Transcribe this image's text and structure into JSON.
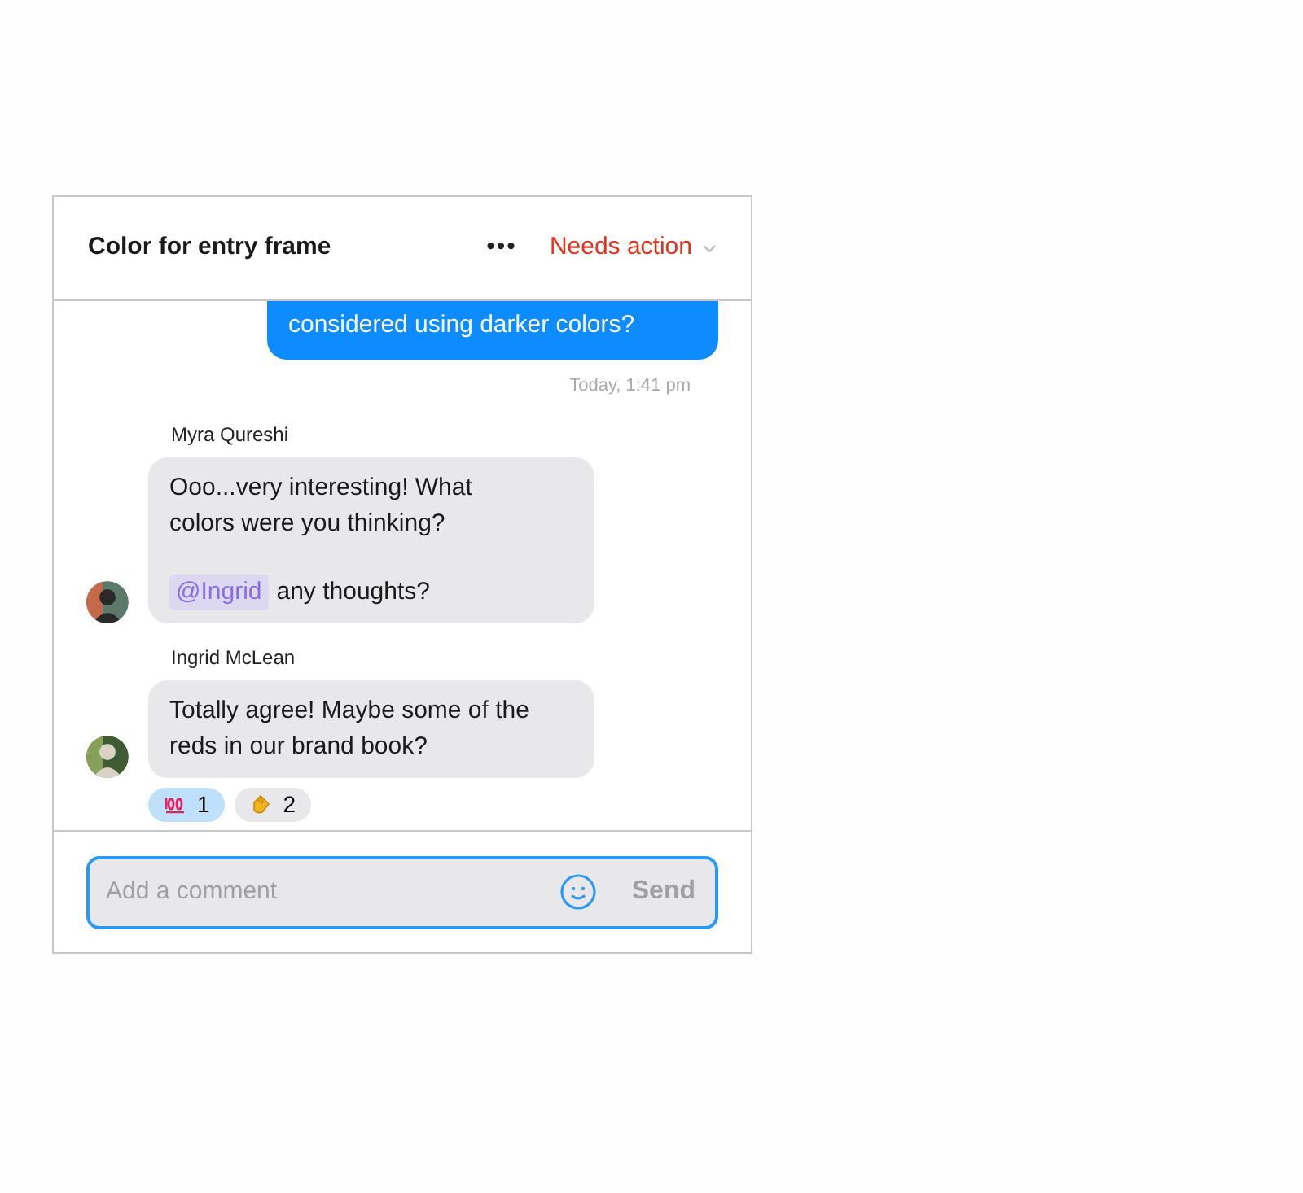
{
  "header": {
    "title": "Color for entry frame",
    "more": "•••",
    "status": "Needs action"
  },
  "own_message": {
    "text": "considered using darker colors?",
    "time": "Today, 1:41 pm"
  },
  "messages": [
    {
      "author": "Myra Qureshi",
      "avatar": {
        "kind": "picture"
      },
      "paragraphs": [
        {
          "parts": [
            {
              "kind": "text",
              "text": "Ooo...very interesting! What colors were you thinking?"
            }
          ]
        },
        {
          "parts": [
            {
              "kind": "mention",
              "text": "@Ingrid"
            },
            {
              "kind": "text",
              "text": "any thoughts?"
            }
          ]
        }
      ]
    },
    {
      "author": "Ingrid McLean",
      "avatar": {
        "kind": "picture"
      },
      "paragraphs": [
        {
          "parts": [
            {
              "kind": "text",
              "text": "Totally agree! Maybe some of the reds in our brand book?"
            }
          ]
        }
      ],
      "reactions": [
        {
          "kind": "hundred",
          "count": "1",
          "selected": true
        },
        {
          "kind": "clap",
          "count": "2",
          "selected": false
        }
      ]
    }
  ],
  "composer": {
    "placeholder": "Add a comment",
    "send": "Send"
  }
}
